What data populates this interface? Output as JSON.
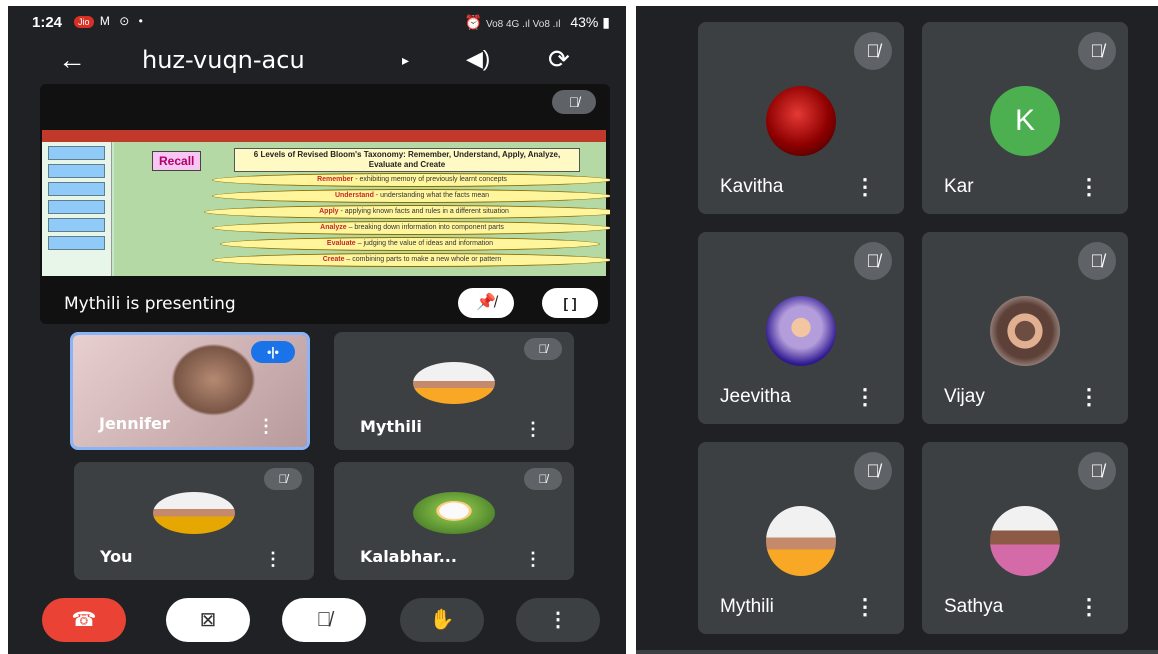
{
  "left_screen": {
    "status_bar": {
      "time": "1:24",
      "carrier_badge": "Jio",
      "left_glyphs": "M ⊙ •",
      "signal": "Vo8 4G .ıl Vo8 .ıl",
      "battery": "43%"
    },
    "top_bar": {
      "meeting_code": "huz-vuqn-acu"
    },
    "presentation": {
      "label": "Mythili is presenting",
      "slide": {
        "recall_tag": "Recall",
        "title": "6 Levels of Revised Bloom's Taxonomy: Remember, Understand, Apply, Analyze, Evaluate and Create",
        "levels": [
          {
            "term": "Remember",
            "text": " - exhibiting memory of previously learnt concepts"
          },
          {
            "term": "Understand",
            "text": " - understanding what the facts mean"
          },
          {
            "term": "Apply",
            "text": " - applying known facts and rules in a different situation"
          },
          {
            "term": "Analyze",
            "text": " – breaking down information into component parts"
          },
          {
            "term": "Evaluate",
            "text": " – judging the value of ideas and information"
          },
          {
            "term": "Create",
            "text": " – combining parts to make a new whole or pattern"
          }
        ]
      }
    },
    "tiles": [
      {
        "name": "Jennifer",
        "speaking": true
      },
      {
        "name": "Mythili"
      },
      {
        "name": "You"
      },
      {
        "name": "Kalabhar..."
      }
    ]
  },
  "right_screen": {
    "tiles": [
      {
        "name": "Kavitha"
      },
      {
        "name": "Kar",
        "initial": "K"
      },
      {
        "name": "Jeevitha"
      },
      {
        "name": "Vijay"
      },
      {
        "name": "Mythili"
      },
      {
        "name": "Sathya"
      }
    ]
  },
  "icons": {
    "back": "←",
    "caret": "▸",
    "speaker": "🔈",
    "camera_flip": "⟳",
    "mic_off": "⚲",
    "pin_off": "✕",
    "fullscreen": "⛶",
    "more": "⋮",
    "end_call": "☎",
    "camera_off": "⊠",
    "raise_hand": "✋",
    "speaking": "•|•"
  },
  "colors": {
    "background": "#202124",
    "tile": "#3c4043",
    "end_call": "#ea4335",
    "speaking": "#1a73e8",
    "avatar_k": "#4caf50"
  }
}
